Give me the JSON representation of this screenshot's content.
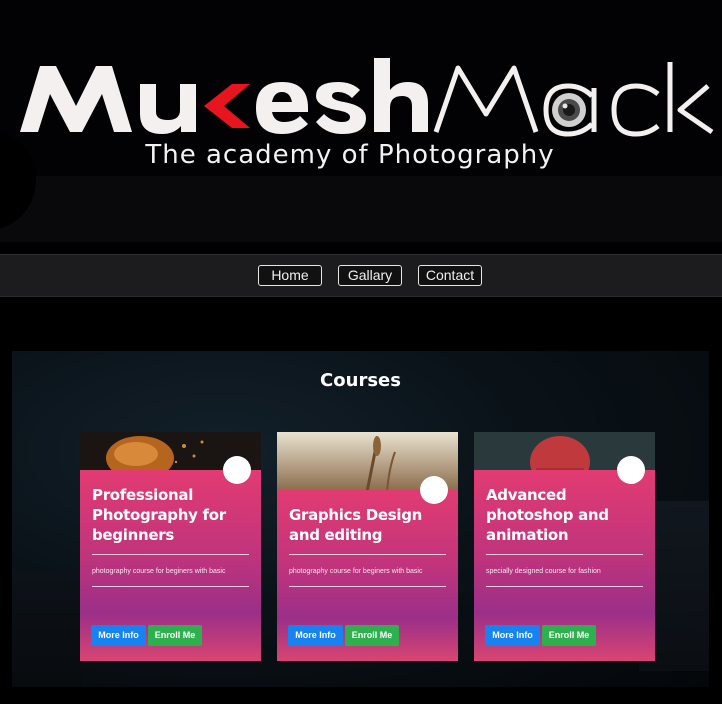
{
  "header": {
    "brand_first": "Mukesh",
    "brand_second": "Mack",
    "tagline": "The academy of Photography"
  },
  "nav": {
    "items": [
      {
        "label": "Home"
      },
      {
        "label": "Gallary"
      },
      {
        "label": "Contact"
      }
    ]
  },
  "courses": {
    "title": "Courses",
    "cards": [
      {
        "title": "Professional Photography for beginners",
        "description": "photography course for beginers with basic",
        "more_info_label": "More Info",
        "enroll_label": "Enroll Me"
      },
      {
        "title": "Graphics Design and editing",
        "description": "photography course for beginers with basic",
        "more_info_label": "More Info",
        "enroll_label": "Enroll Me"
      },
      {
        "title": "Advanced photoshop and animation",
        "description": "specially designed course for fashion",
        "more_info_label": "More Info",
        "enroll_label": "Enroll Me"
      }
    ]
  },
  "colors": {
    "card_gradient_top": "#e23b72",
    "card_gradient_mid": "#9b2f88",
    "more_info_button": "#1683f0",
    "enroll_button": "#2fb04e",
    "logo_accent_red": "#e8141e"
  }
}
